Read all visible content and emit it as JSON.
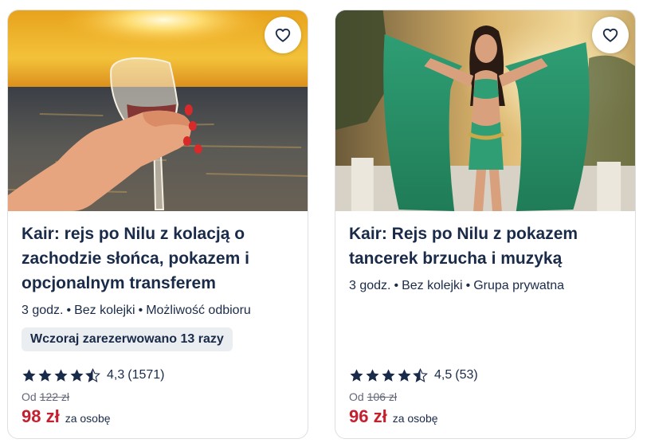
{
  "cards": [
    {
      "title": "Kair: rejs po Nilu z kolacją o zachodzie słońca, pokazem i opcjonalnym transferem",
      "meta": [
        "3 godz.",
        "Bez kolejki",
        "Możliwość odbioru"
      ],
      "badge": "Wczoraj zarezerwowano 13 razy",
      "rating": 4.3,
      "rating_label": "4,3",
      "reviews": "(1571)",
      "from_label": "Od",
      "old_price": "122 zł",
      "price": "98 zł",
      "price_unit": "za osobę",
      "wishlist_icon": "heart-outline-icon"
    },
    {
      "title": "Kair: Rejs po Nilu z pokazem tancerek brzucha i muzyką",
      "meta": [
        "3 godz.",
        "Bez kolejki",
        "Grupa prywatna"
      ],
      "rating": 4.5,
      "rating_label": "4,5",
      "reviews": "(53)",
      "from_label": "Od",
      "old_price": "106 zł",
      "price": "96 zł",
      "price_unit": "za osobę",
      "wishlist_icon": "heart-outline-icon"
    }
  ],
  "colors": {
    "text": "#1a2b49",
    "price": "#c4202f",
    "badge_bg": "#ebeef1",
    "border": "#dcdfe4"
  }
}
